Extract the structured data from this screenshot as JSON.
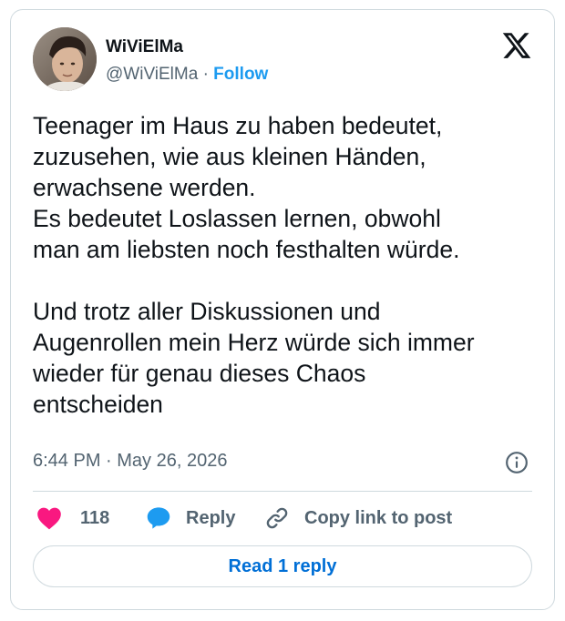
{
  "author": {
    "display_name": "WiViElMa",
    "handle": "@WiViElMa",
    "separator": "·",
    "follow_label": "Follow"
  },
  "tweet": {
    "paragraphs": [
      "Teenager im Haus zu haben bedeutet, zuzusehen, wie aus kleinen Händen, erwachsene werden. Es bedeutet Loslassen lernen, obwohl man am liebsten noch festhalten würde.",
      "Und trotz aller Diskussionen und Augenrollen mein Herz würde sich immer wieder für genau dieses Chaos entscheiden"
    ],
    "lines": {
      "l1": "Teenager im Haus zu haben bedeutet,",
      "l2": "zuzusehen, wie aus kleinen Händen,",
      "l3": "erwachsene werden.",
      "l4": "Es bedeutet Loslassen lernen, obwohl",
      "l5": "man am liebsten noch festhalten würde.",
      "l6": "Und trotz aller Diskussionen und",
      "l7": "Augenrollen mein Herz würde sich immer",
      "l8": "wieder für genau dieses Chaos",
      "l9": "entscheiden"
    },
    "timestamp": "6:44 PM · May 26, 2026"
  },
  "actions": {
    "like_count": "118",
    "reply_label": "Reply",
    "copy_link_label": "Copy link to post"
  },
  "read_replies_label": "Read 1 reply",
  "icons": {
    "logo": "x-logo-icon",
    "info": "info-icon",
    "like": "heart-icon",
    "reply": "speech-bubble-icon",
    "copy": "link-icon"
  },
  "colors": {
    "heart": "#f91880",
    "reply_bubble": "#1d9bf0",
    "follow_link": "#1d9bf0",
    "read_reply": "#006fd6",
    "secondary_text": "#536471"
  }
}
